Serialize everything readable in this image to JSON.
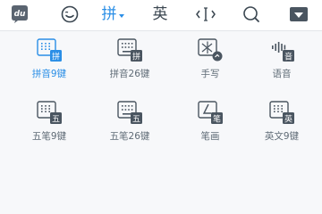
{
  "toolbar": {
    "logo_text": "du",
    "items": [
      {
        "icon": "emoji-icon"
      },
      {
        "label": "拼",
        "active": true
      },
      {
        "label": "英"
      },
      {
        "icon": "cursor-move-icon"
      },
      {
        "icon": "search-icon"
      },
      {
        "icon": "collapse-keyboard-icon"
      }
    ]
  },
  "layouts": [
    {
      "label": "拼音9键",
      "badge": "拼",
      "type": "grid9",
      "selected": true
    },
    {
      "label": "拼音26键",
      "badge": "拼",
      "type": "grid26",
      "selected": false
    },
    {
      "label": "手写",
      "badge": "",
      "type": "handwrite",
      "selected": false
    },
    {
      "label": "语音",
      "badge": "音",
      "type": "voice",
      "selected": false
    },
    {
      "label": "五笔9键",
      "badge": "五",
      "type": "grid9",
      "selected": false
    },
    {
      "label": "五笔26键",
      "badge": "五",
      "type": "grid26",
      "selected": false
    },
    {
      "label": "笔画",
      "badge": "笔",
      "type": "stroke",
      "selected": false
    },
    {
      "label": "英文9键",
      "badge": "英",
      "type": "grid9",
      "selected": false
    }
  ],
  "colors": {
    "accent": "#2a8ee6",
    "icon": "#4a5560"
  }
}
